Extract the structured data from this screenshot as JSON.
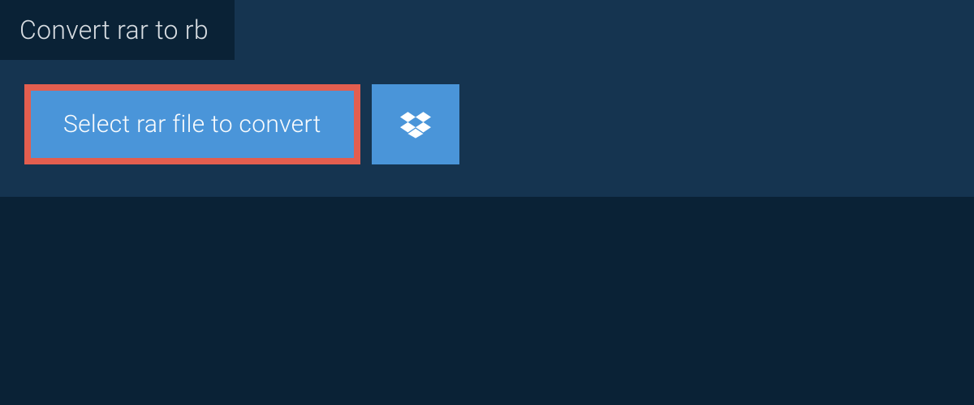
{
  "header": {
    "tab_title": "Convert rar to rb"
  },
  "actions": {
    "select_file_label": "Select rar file to convert"
  },
  "colors": {
    "page_bg": "#0a2236",
    "panel_bg": "#153450",
    "button_bg": "#4a95d9",
    "highlight_border": "#e35e4f",
    "text_light": "#d8dde2",
    "text_button": "#fafcfd"
  }
}
